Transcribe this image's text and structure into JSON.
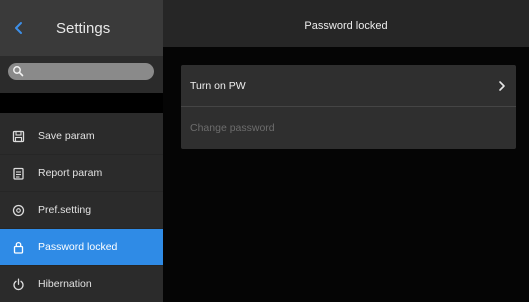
{
  "sidebar": {
    "title": "Settings",
    "back_icon": "chevron-left-icon",
    "search": {
      "placeholder": "",
      "icon": "search-icon"
    },
    "items": [
      {
        "label": "Save param",
        "icon": "save-icon",
        "active": false
      },
      {
        "label": "Report param",
        "icon": "report-icon",
        "active": false
      },
      {
        "label": "Pref.setting",
        "icon": "preferences-icon",
        "active": false
      },
      {
        "label": "Password locked",
        "icon": "lock-icon",
        "active": true
      },
      {
        "label": "Hibernation",
        "icon": "power-icon",
        "active": false
      }
    ]
  },
  "header": {
    "title": "Password locked"
  },
  "main": {
    "rows": [
      {
        "label": "Turn on PW",
        "enabled": true,
        "icon": "chevron-right-icon"
      },
      {
        "label": "Change password",
        "enabled": false
      }
    ]
  },
  "colors": {
    "accent": "#2f8be6",
    "sidebar_bg": "#2b2b2b",
    "card_bg": "#2f2f2f",
    "disabled_text": "#6d6d6d"
  }
}
